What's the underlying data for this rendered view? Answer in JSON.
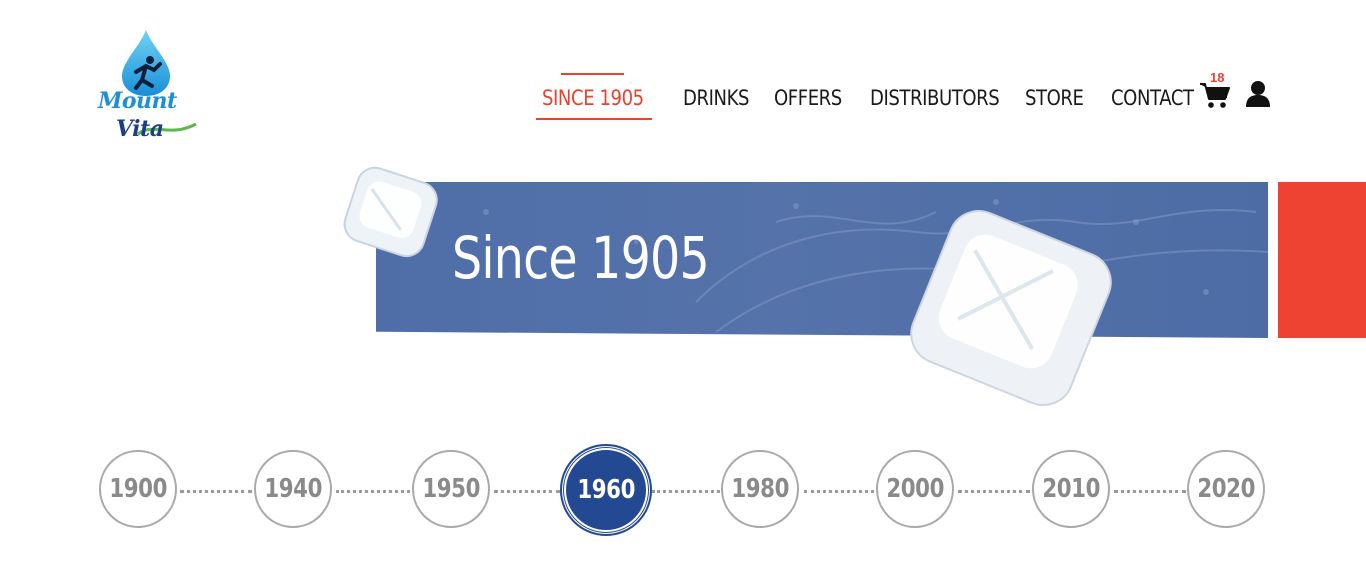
{
  "brand": {
    "name_line1": "Mount",
    "name_line2": "Vita"
  },
  "nav": {
    "items": [
      {
        "label": "SINCE 1905",
        "active": true
      },
      {
        "label": "DRINKS",
        "active": false
      },
      {
        "label": "OFFERS",
        "active": false
      },
      {
        "label": "DISTRIBUTORS",
        "active": false
      },
      {
        "label": "STORE",
        "active": false
      },
      {
        "label": "CONTACT",
        "active": false
      }
    ],
    "cart_icon": "cart-icon",
    "cart_count": "18",
    "user_icon": "user-icon"
  },
  "hero": {
    "title": "Since 1905"
  },
  "timeline": {
    "years": [
      "1900",
      "1940",
      "1950",
      "1960",
      "1980",
      "2000",
      "2010",
      "2020"
    ],
    "active_year": "1960"
  },
  "colors": {
    "accent_red": "#e8432e",
    "hero_blue": "#5270a9",
    "active_year_blue": "#244993",
    "text_dark": "#1a1a1a",
    "year_gray": "#8a8a8a"
  }
}
